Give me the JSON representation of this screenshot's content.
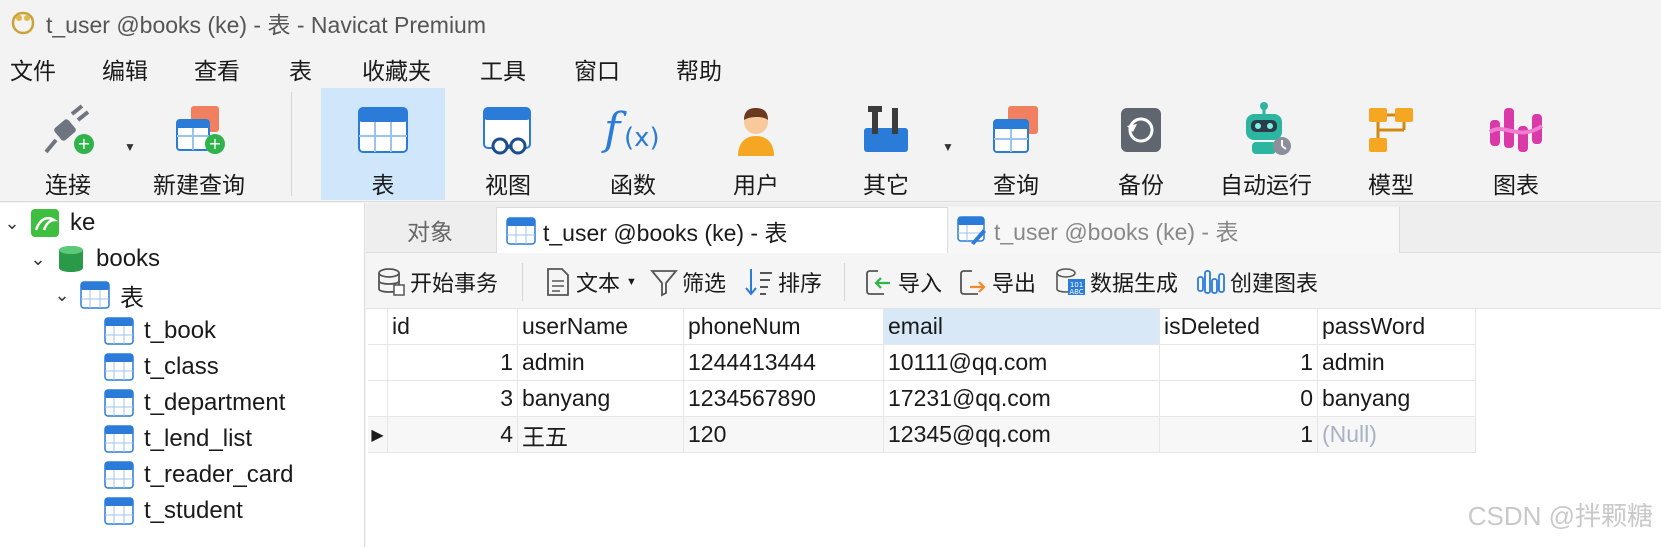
{
  "window": {
    "title": "t_user @books (ke) - 表 - Navicat Premium"
  },
  "menu": [
    "文件",
    "编辑",
    "查看",
    "表",
    "收藏夹",
    "工具",
    "窗口",
    "帮助"
  ],
  "toolbar": {
    "connect": "连接",
    "new_query": "新建查询",
    "table": "表",
    "view": "视图",
    "function": "函数",
    "user": "用户",
    "other": "其它",
    "query": "查询",
    "backup": "备份",
    "automation": "自动运行",
    "model": "模型",
    "chart": "图表"
  },
  "tree": {
    "connection": "ke",
    "database": "books",
    "tables_group": "表",
    "tables": [
      "t_book",
      "t_class",
      "t_department",
      "t_lend_list",
      "t_reader_card",
      "t_student"
    ]
  },
  "tabs": {
    "objects": "对象",
    "active": "t_user @books (ke) - 表",
    "inactive": "t_user @books (ke) - 表"
  },
  "subtoolbar": {
    "begin_tx": "开始事务",
    "text": "文本",
    "filter": "筛选",
    "sort": "排序",
    "import": "导入",
    "export": "导出",
    "data_gen": "数据生成",
    "create_chart": "创建图表"
  },
  "grid": {
    "columns": [
      "id",
      "userName",
      "phoneNum",
      "email",
      "isDeleted",
      "passWord"
    ],
    "rows": [
      [
        "1",
        "admin",
        "1244413444",
        "10111@qq.com",
        "1",
        "admin"
      ],
      [
        "3",
        "banyang",
        "1234567890",
        "17231@qq.com",
        "0",
        "banyang"
      ],
      [
        "4",
        "王五",
        "120",
        "12345@qq.com",
        "1",
        "(Null)"
      ]
    ]
  },
  "watermark": "CSDN @拌颗糖"
}
